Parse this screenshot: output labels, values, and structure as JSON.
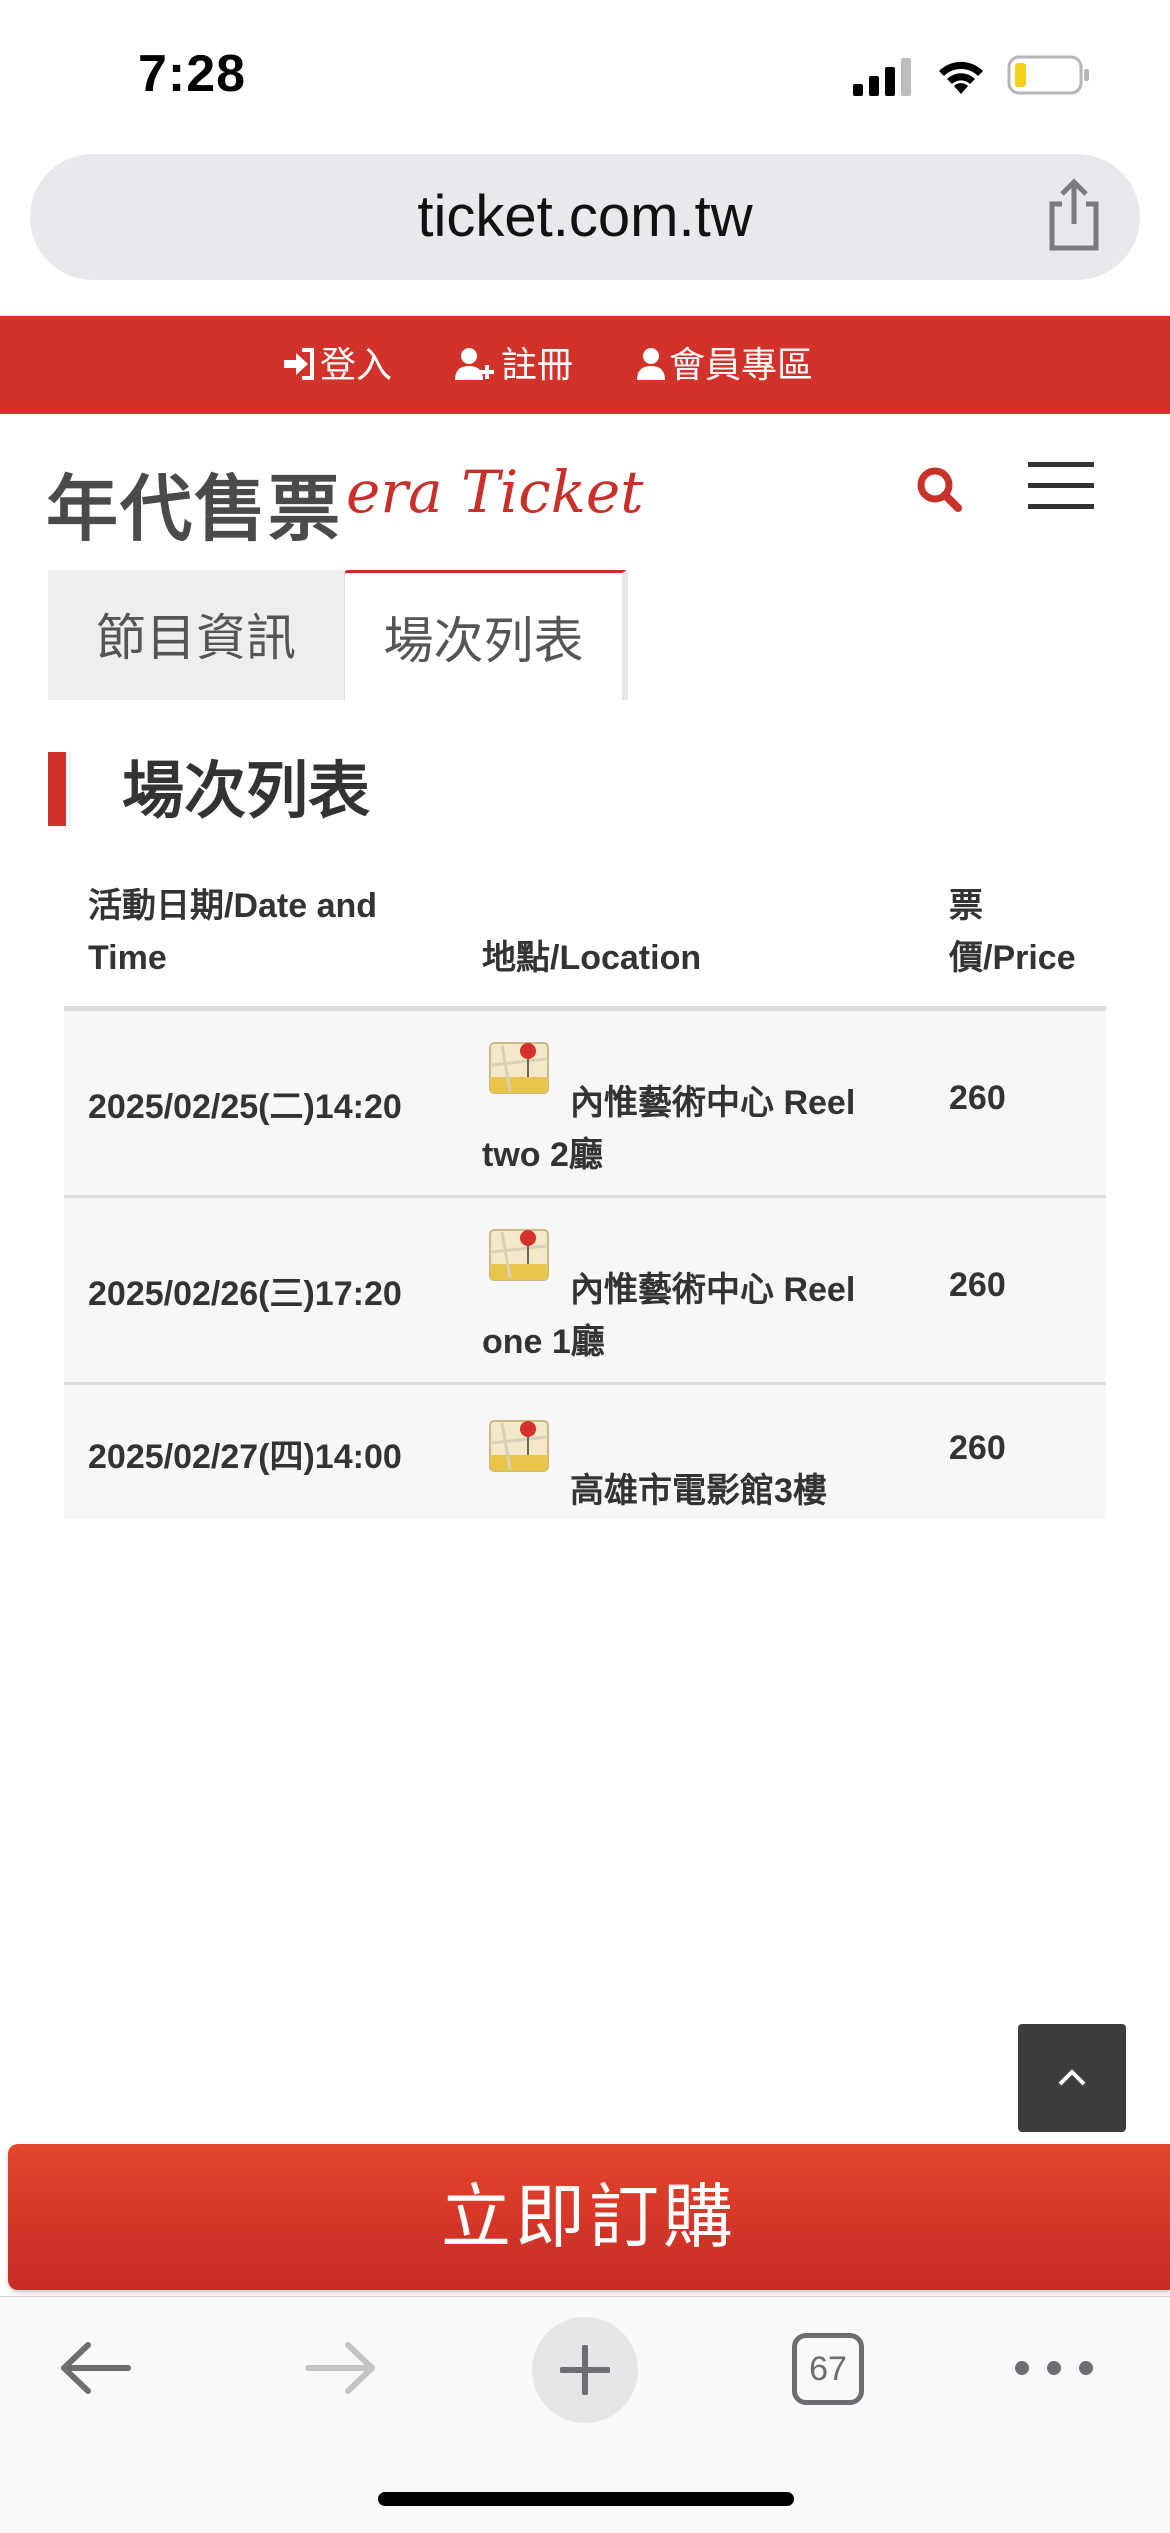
{
  "status_bar": {
    "time": "7:28",
    "icons": [
      "signal-icon",
      "wifi-icon",
      "battery-icon"
    ]
  },
  "browser": {
    "url": "ticket.com.tw",
    "tab_count": "67"
  },
  "member_bar": {
    "login": "登入",
    "register": "註冊",
    "member_area": "會員專區"
  },
  "header": {
    "logo_zh": "年代售票",
    "logo_en": "era Ticket"
  },
  "tabs": [
    {
      "label": "節目資訊",
      "active": false
    },
    {
      "label": "場次列表",
      "active": true
    }
  ],
  "section": {
    "title": "場次列表"
  },
  "table": {
    "headers": {
      "date": "活動日期/Date and Time",
      "location": "地點/Location",
      "price": "票價/Price"
    },
    "rows": [
      {
        "date": "2025/02/25(二)14:20",
        "location_line1": "內惟藝術中心 Reel",
        "location_line2": "two 2廳",
        "price": "260"
      },
      {
        "date": "2025/02/26(三)17:20",
        "location_line1": "內惟藝術中心 Reel",
        "location_line2": "one 1廳",
        "price": "260"
      },
      {
        "date": "2025/02/27(四)14:00",
        "location_line1": "高雄市電影館3樓",
        "location_line2": "",
        "price": "260"
      }
    ]
  },
  "buy_button": {
    "label": "立即訂購"
  },
  "colors": {
    "brand_red": "#d1322a",
    "tab_inactive_bg": "#eeeeee",
    "row_bg": "#f7f7f7"
  }
}
